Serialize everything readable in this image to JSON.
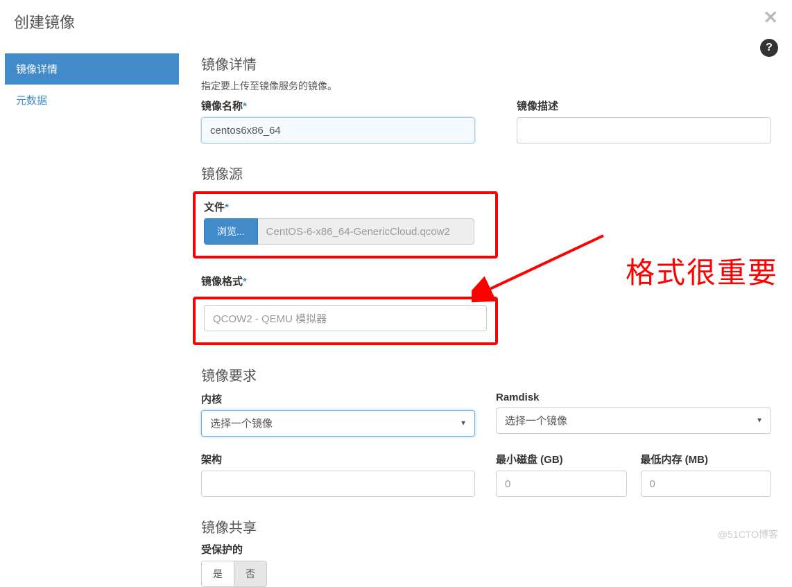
{
  "modal": {
    "title": "创建镜像",
    "close_icon": "✕",
    "help_icon": "?"
  },
  "sidebar": {
    "items": [
      {
        "label": "镜像详情",
        "active": true
      },
      {
        "label": "元数据",
        "active": false
      }
    ]
  },
  "form": {
    "details": {
      "heading": "镜像详情",
      "subheading": "指定要上传至镜像服务的镜像。",
      "name_label": "镜像名称",
      "name_value": "centos6x86_64",
      "desc_label": "镜像描述",
      "desc_value": ""
    },
    "source": {
      "heading": "镜像源",
      "file_label": "文件",
      "browse_label": "浏览...",
      "file_name": "CentOS-6-x86_64-GenericCloud.qcow2",
      "format_label": "镜像格式",
      "format_value": "QCOW2 - QEMU 模拟器"
    },
    "requirements": {
      "heading": "镜像要求",
      "kernel_label": "内核",
      "kernel_placeholder": "选择一个镜像",
      "ramdisk_label": "Ramdisk",
      "ramdisk_placeholder": "选择一个镜像",
      "arch_label": "架构",
      "arch_value": "",
      "min_disk_label": "最小磁盘 (GB)",
      "min_disk_value": "0",
      "min_ram_label": "最低内存 (MB)",
      "min_ram_value": "0"
    },
    "sharing": {
      "heading": "镜像共享",
      "protected_label": "受保护的",
      "yes_label": "是",
      "no_label": "否"
    }
  },
  "annotation": {
    "text": "格式很重要"
  },
  "watermark": "@51CTO博客"
}
